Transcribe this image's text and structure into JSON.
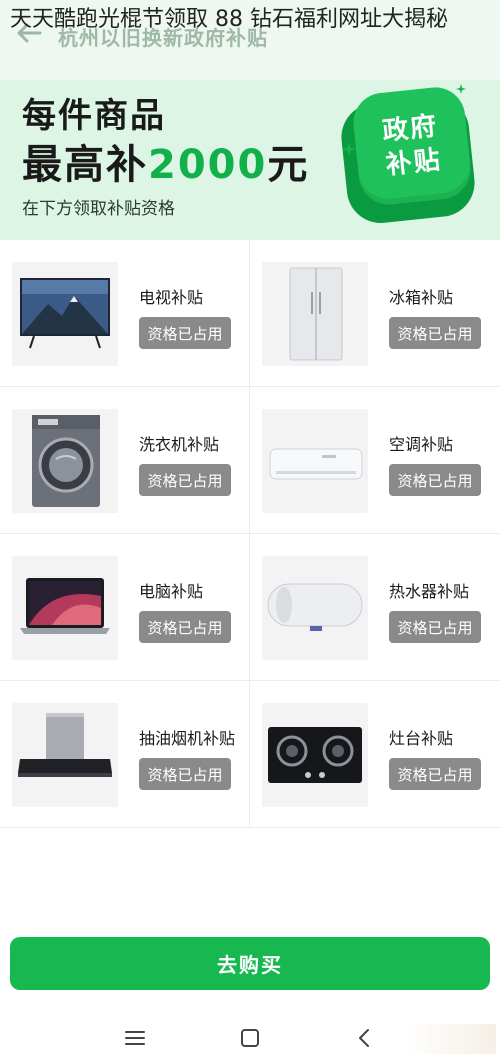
{
  "overlay_title": "天天酷跑光棍节领取 88 钻石福利网址大揭秘",
  "nav": {
    "title": "杭州以旧换新政府补贴",
    "back_icon": "arrow-left-icon"
  },
  "banner": {
    "line1": "每件商品",
    "line2_prefix": "最高补",
    "line2_amount": "2000",
    "line2_suffix": "元",
    "line3": "在下方领取补贴资格",
    "badge_line1": "政府",
    "badge_line2": "补贴",
    "accent": "#1fc25a",
    "background": "#dcf5e4"
  },
  "products": [
    {
      "name": "电视补贴",
      "button": "资格已占用",
      "icon": "tv-icon"
    },
    {
      "name": "冰箱补贴",
      "button": "资格已占用",
      "icon": "fridge-icon"
    },
    {
      "name": "洗衣机补贴",
      "button": "资格已占用",
      "icon": "washing-machine-icon"
    },
    {
      "name": "空调补贴",
      "button": "资格已占用",
      "icon": "air-conditioner-icon"
    },
    {
      "name": "电脑补贴",
      "button": "资格已占用",
      "icon": "laptop-icon"
    },
    {
      "name": "热水器补贴",
      "button": "资格已占用",
      "icon": "water-heater-icon"
    },
    {
      "name": "抽油烟机补贴",
      "button": "资格已占用",
      "icon": "range-hood-icon"
    },
    {
      "name": "灶台补贴",
      "button": "资格已占用",
      "icon": "gas-stove-icon"
    }
  ],
  "buy_button": "去购买",
  "button_color": "#17b84f",
  "disabled_color": "#8a8a8a",
  "system_nav": {
    "menu_icon": "menu-icon",
    "home_icon": "home-square-icon",
    "back_icon": "back-chevron-icon"
  }
}
